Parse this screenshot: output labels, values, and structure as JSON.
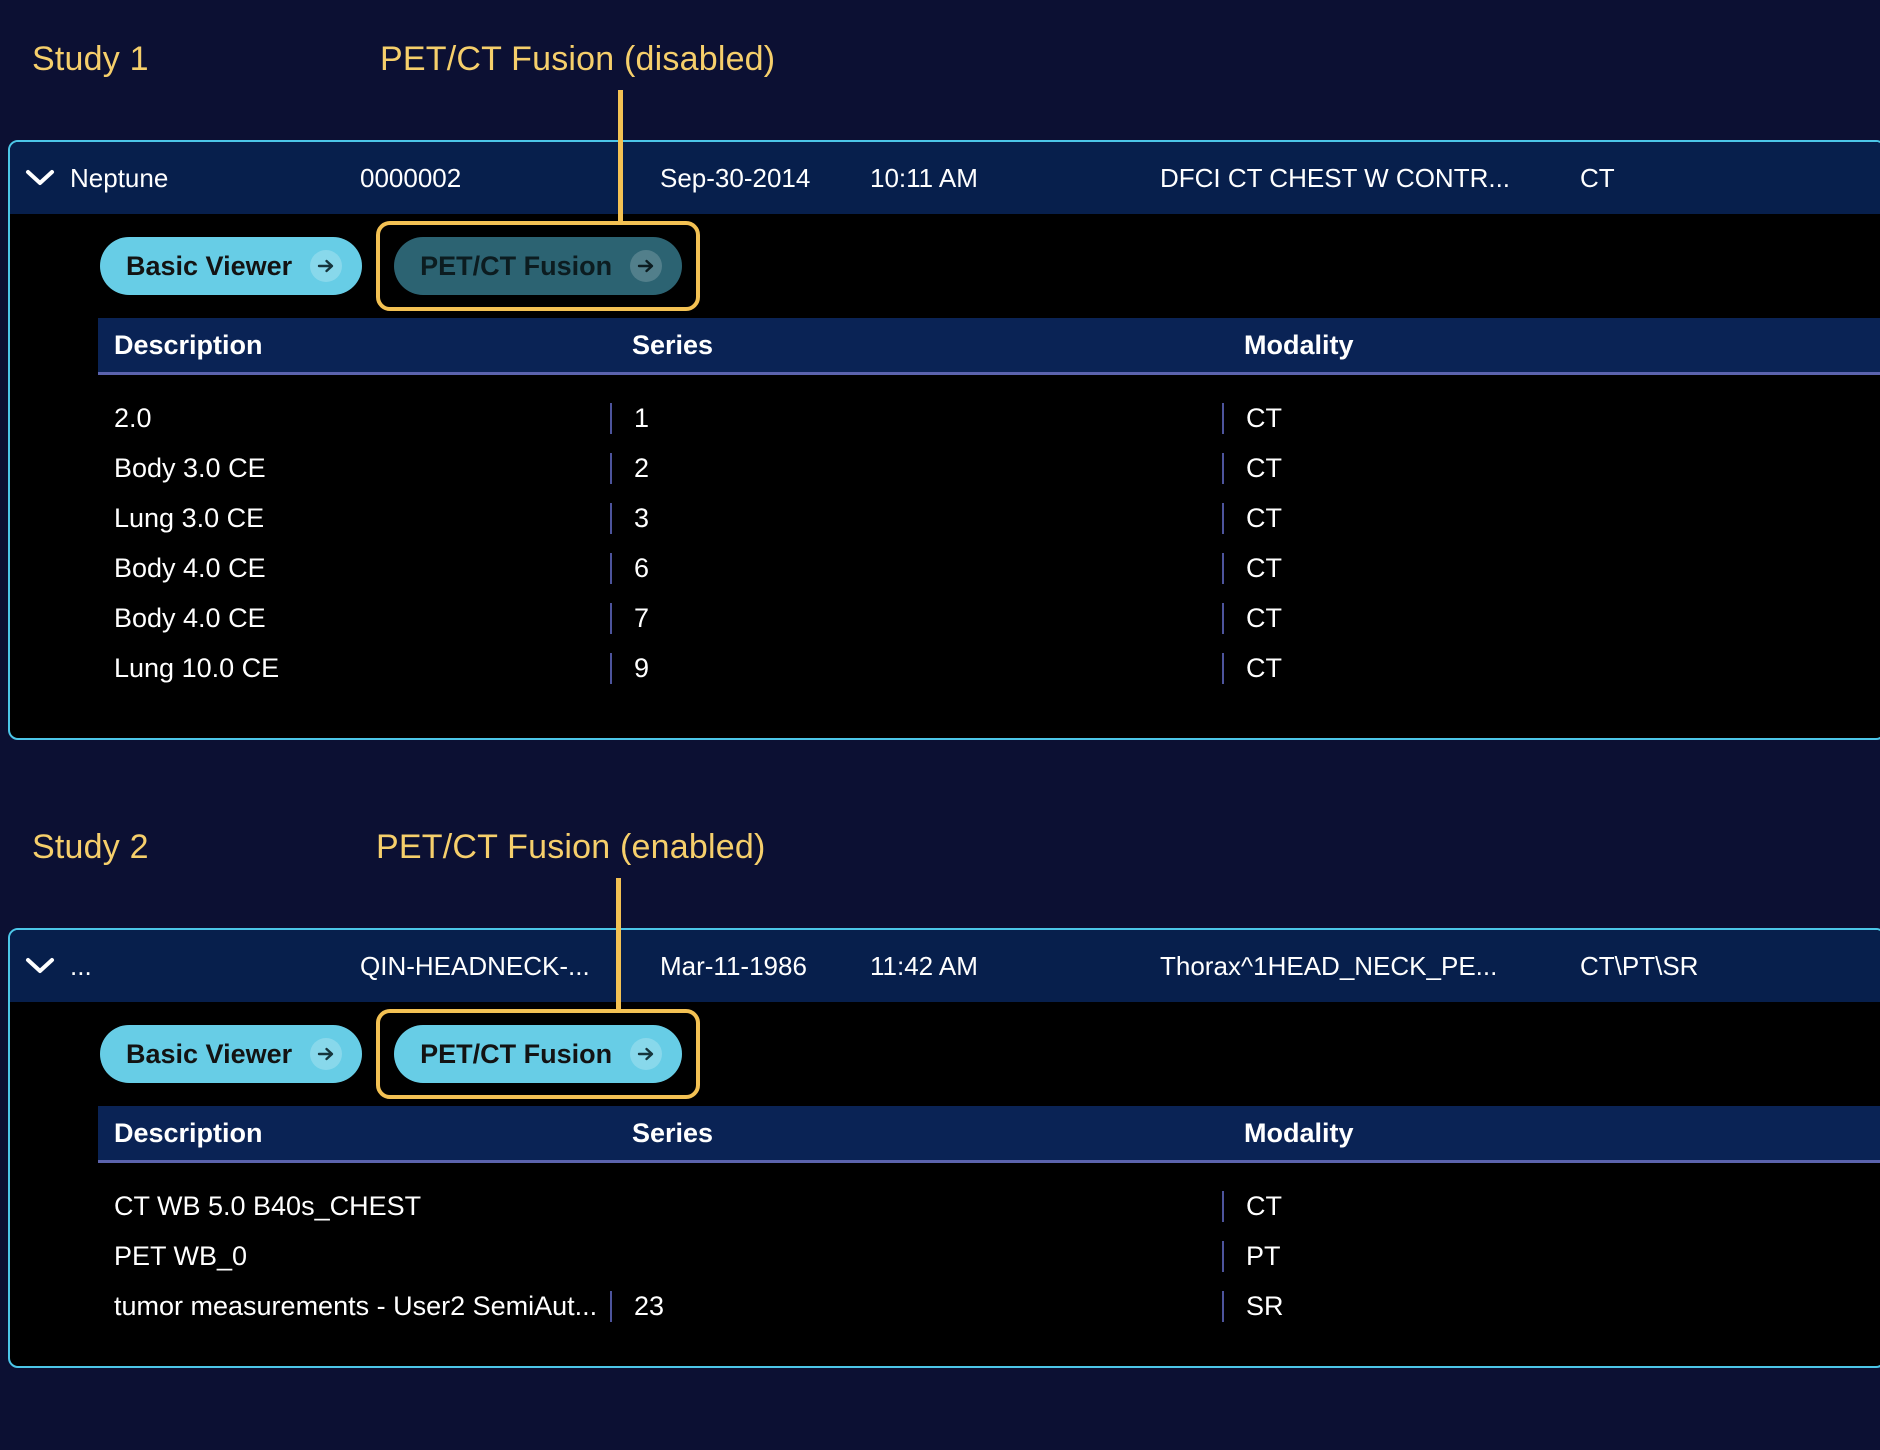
{
  "colors": {
    "page_background": "#0c1033",
    "panel_background": "#000000",
    "panel_border": "#4cc6e8",
    "header_background": "#071f4c",
    "annotation": "#f6cf6b",
    "highlight_outline": "#f3c153",
    "button_enabled": "#67cde6",
    "button_disabled": "#2c6372",
    "table_header_background": "#0a2355",
    "table_rule": "#5b63ad"
  },
  "annotations": [
    {
      "id": "study-1",
      "text": "Study 1"
    },
    {
      "id": "pet-ct-disabled",
      "text": "PET/CT Fusion (disabled)"
    },
    {
      "id": "study-2",
      "text": "Study 2"
    },
    {
      "id": "pet-ct-enabled",
      "text": "PET/CT Fusion (enabled)"
    }
  ],
  "studies": [
    {
      "header": {
        "expand_icon": "chevron-down-icon",
        "patient_name": "Neptune",
        "patient_id": "0000002",
        "date": "Sep-30-2014",
        "time": "10:11 AM",
        "description": "DFCI CT CHEST W CONTR...",
        "modality": "CT"
      },
      "buttons": {
        "basic_viewer": {
          "label": "Basic Viewer",
          "state": "enabled",
          "arrow_icon": "arrow-right-icon"
        },
        "pet_ct_fusion": {
          "label": "PET/CT Fusion",
          "state": "disabled",
          "arrow_icon": "arrow-right-icon"
        }
      },
      "table": {
        "columns": [
          "Description",
          "Series",
          "Modality"
        ],
        "rows": [
          {
            "description": "2.0",
            "series": "1",
            "modality": "CT"
          },
          {
            "description": "Body 3.0 CE",
            "series": "2",
            "modality": "CT"
          },
          {
            "description": "Lung 3.0 CE",
            "series": "3",
            "modality": "CT"
          },
          {
            "description": "Body 4.0 CE",
            "series": "6",
            "modality": "CT"
          },
          {
            "description": "Body 4.0 CE",
            "series": "7",
            "modality": "CT"
          },
          {
            "description": "Lung 10.0 CE",
            "series": "9",
            "modality": "CT"
          }
        ]
      }
    },
    {
      "header": {
        "expand_icon": "chevron-down-icon",
        "patient_name": "...",
        "patient_id": "QIN-HEADNECK-...",
        "date": "Mar-11-1986",
        "time": "11:42 AM",
        "description": "Thorax^1HEAD_NECK_PE...",
        "modality": "CT\\PT\\SR"
      },
      "buttons": {
        "basic_viewer": {
          "label": "Basic Viewer",
          "state": "enabled",
          "arrow_icon": "arrow-right-icon"
        },
        "pet_ct_fusion": {
          "label": "PET/CT Fusion",
          "state": "enabled",
          "arrow_icon": "arrow-right-icon"
        }
      },
      "table": {
        "columns": [
          "Description",
          "Series",
          "Modality"
        ],
        "rows": [
          {
            "description": "CT WB 5.0 B40s_CHEST",
            "series": "",
            "modality": "CT"
          },
          {
            "description": "PET WB_0",
            "series": "",
            "modality": "PT"
          },
          {
            "description": "tumor measurements - User2 SemiAut...",
            "series": "23",
            "modality": "SR"
          }
        ]
      }
    }
  ]
}
